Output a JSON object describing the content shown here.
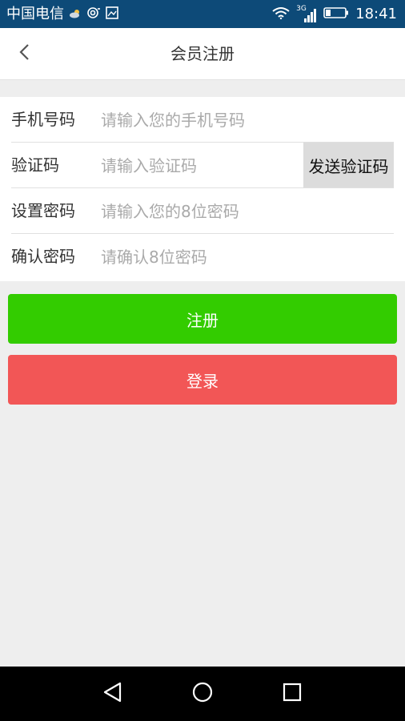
{
  "status_bar": {
    "carrier": "中国电信",
    "time": "18:41",
    "network_type": "3G",
    "icons": [
      "weather-cloud-icon",
      "camera-icon",
      "image-icon",
      "wifi-icon",
      "signal-icon",
      "battery-icon"
    ]
  },
  "header": {
    "title": "会员注册",
    "back_icon": "chevron-left-icon"
  },
  "form": {
    "phone": {
      "label": "手机号码",
      "placeholder": "请输入您的手机号码",
      "value": ""
    },
    "code": {
      "label": "验证码",
      "placeholder": "请输入验证码",
      "value": "",
      "send_label": "发送验证码"
    },
    "password": {
      "label": "设置密码",
      "placeholder": "请输入您的8位密码",
      "value": ""
    },
    "confirm": {
      "label": "确认密码",
      "placeholder": "请确认8位密码",
      "value": ""
    }
  },
  "actions": {
    "register_label": "注册",
    "login_label": "登录"
  },
  "colors": {
    "status_bar": "#0d4a78",
    "register": "#33cc00",
    "login": "#f25656",
    "background": "#eeeeee"
  },
  "nav": {
    "icons": [
      "nav-back-icon",
      "nav-home-icon",
      "nav-recents-icon"
    ]
  }
}
